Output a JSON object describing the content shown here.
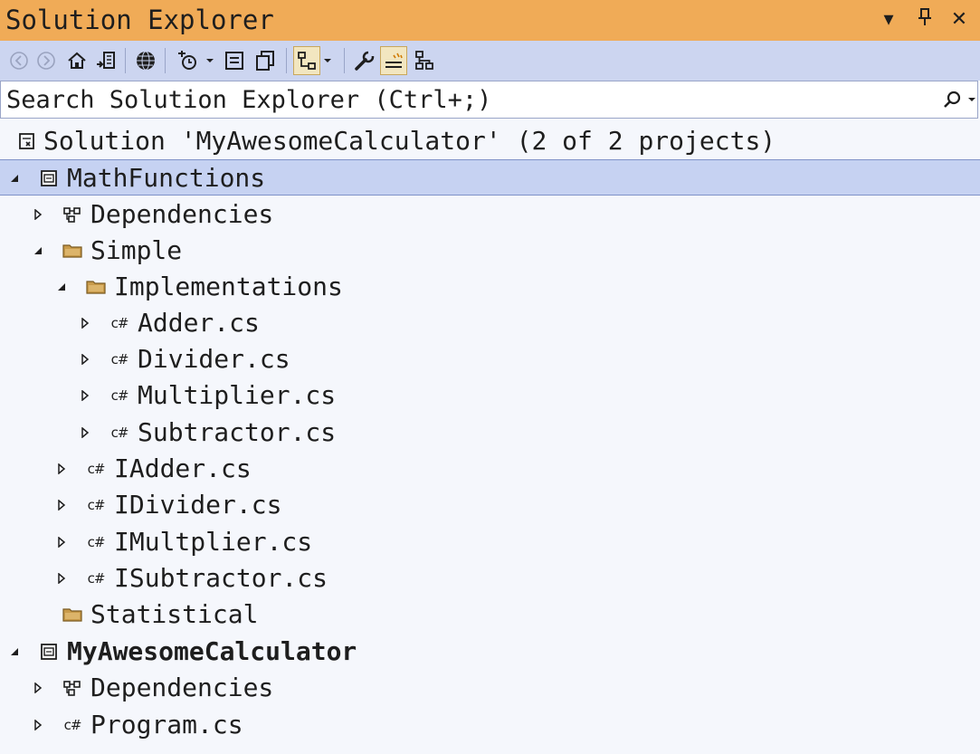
{
  "window": {
    "title": "Solution Explorer"
  },
  "title_controls": [
    {
      "name": "window-position-dropdown-icon",
      "glyph": "▾"
    },
    {
      "name": "pin-icon",
      "glyph": "⊥"
    },
    {
      "name": "close-icon",
      "glyph": "✕"
    }
  ],
  "toolbar": {
    "buttons": [
      "back-icon",
      "forward-icon",
      "home-icon",
      "switch-views-icon",
      "web-icon",
      "pending-changes-filter-icon",
      "collapse-all-icon",
      "show-all-files-icon",
      "sync-with-active-document-icon",
      "properties-icon",
      "preview-selected-items-icon",
      "class-view-icon"
    ]
  },
  "search": {
    "placeholder": "Search Solution Explorer (Ctrl+;)"
  },
  "tree": {
    "solution": "Solution 'MyAwesomeCalculator' (2 of 2 projects)",
    "projects": [
      {
        "name": "MathFunctions",
        "selected": true,
        "items": {
          "dependencies": "Dependencies",
          "simple_folder": "Simple",
          "implementations_folder": "Implementations",
          "implementation_files": [
            "Adder.cs",
            "Divider.cs",
            "Multiplier.cs",
            "Subtractor.cs"
          ],
          "interface_files": [
            "IAdder.cs",
            "IDivider.cs",
            "IMultplier.cs",
            "ISubtractor.cs"
          ],
          "statistical_folder": "Statistical"
        }
      },
      {
        "name": "MyAwesomeCalculator",
        "bold": true,
        "items": {
          "dependencies": "Dependencies",
          "program_file": "Program.cs"
        }
      }
    ]
  },
  "colors": {
    "titlebar": "#f0ab57",
    "toolbar": "#ccd5f0",
    "background": "#f5f7fc",
    "selection": "#c6d2f2",
    "folder": "#c89a4a"
  }
}
